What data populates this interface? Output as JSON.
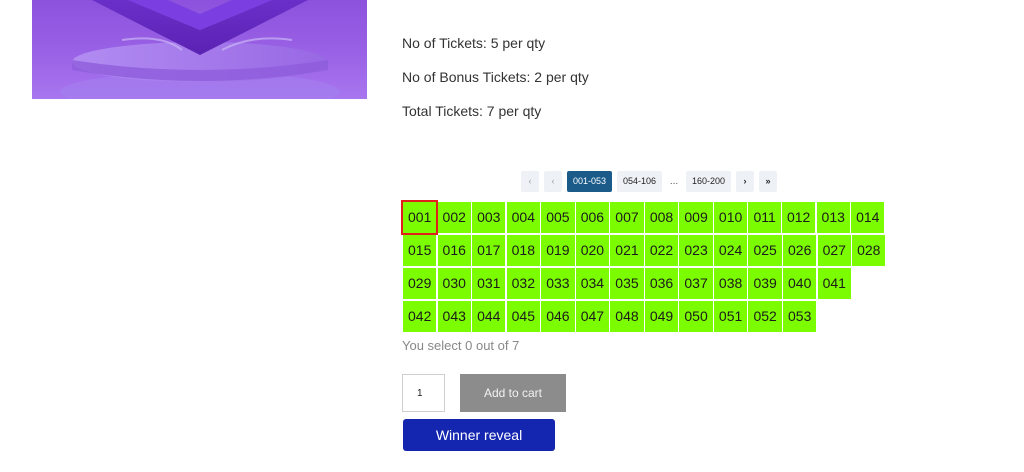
{
  "product": {
    "info": [
      "No of Tickets: 5 per qty",
      "No of Bonus Tickets: 2 per qty",
      "Total Tickets: 7 per qty"
    ]
  },
  "pagination": {
    "first": "‹",
    "prev": "‹",
    "ranges": [
      "001-053",
      "054-106"
    ],
    "ellipsis": "...",
    "last_range": "160-200",
    "next": "›",
    "last": "»",
    "active": "001-053"
  },
  "tickets": [
    "001",
    "002",
    "003",
    "004",
    "005",
    "006",
    "007",
    "008",
    "009",
    "010",
    "011",
    "012",
    "013",
    "014",
    "015",
    "016",
    "017",
    "018",
    "019",
    "020",
    "021",
    "022",
    "023",
    "024",
    "025",
    "026",
    "027",
    "028",
    "029",
    "030",
    "031",
    "032",
    "033",
    "034",
    "035",
    "036",
    "037",
    "038",
    "039",
    "040",
    "041",
    "042",
    "043",
    "044",
    "045",
    "046",
    "047",
    "048",
    "049",
    "050",
    "051",
    "052",
    "053"
  ],
  "selection_status": "You select 0 out of 7",
  "cart": {
    "quantity": "1",
    "add_label": "Add to cart"
  },
  "winner_label": "Winner reveal",
  "colors": {
    "ticket_bg": "#7cfc00",
    "active_page": "#1a5b8a",
    "winner_button": "#1425b0",
    "highlight": "#e0201b"
  }
}
